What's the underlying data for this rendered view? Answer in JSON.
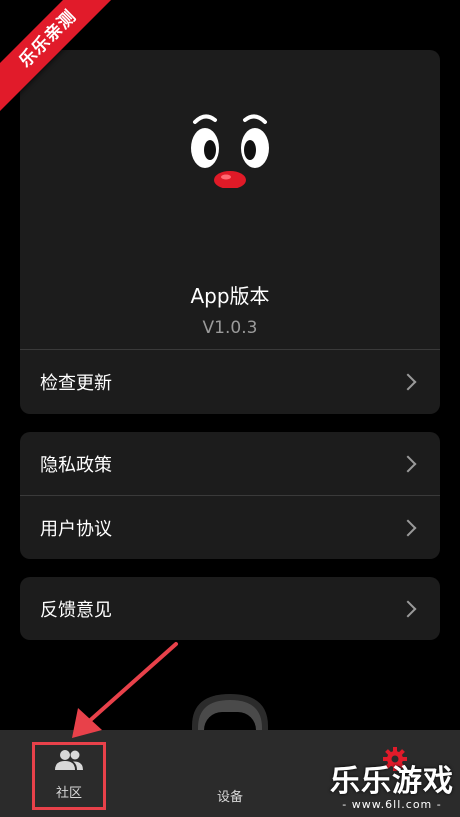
{
  "ribbon": {
    "text": "乐乐亲测"
  },
  "about": {
    "title": "App版本",
    "version": "V1.0.3",
    "check_update": "检查更新"
  },
  "policy": {
    "privacy": "隐私政策",
    "user_agreement": "用户协议"
  },
  "feedback": {
    "label": "反馈意见"
  },
  "nav": {
    "community": "社区",
    "device": "设备"
  },
  "watermark": {
    "main": "乐乐游戏",
    "url": "- www.6ll.com -"
  },
  "colors": {
    "background": "#000000",
    "card": "#1c1c1c",
    "nav": "#2b2b2b",
    "accent_red": "#e11b2a",
    "highlight": "#e8414a"
  },
  "icons": [
    "mascot-icon",
    "chevron-right-icon",
    "people-icon",
    "watch-icon",
    "gear-icon",
    "pointer-arrow-icon"
  ]
}
